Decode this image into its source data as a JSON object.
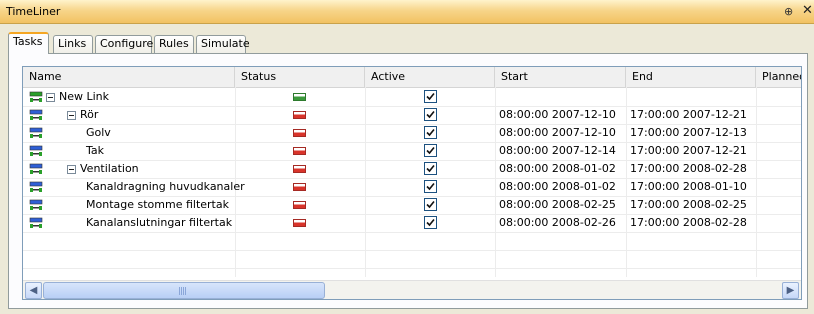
{
  "window": {
    "title": "TimeLiner",
    "pin_glyph": "⊕",
    "close_glyph": "✕"
  },
  "tabs": [
    "Tasks",
    "Links",
    "Configure",
    "Rules",
    "Simulate"
  ],
  "columns": [
    "Name",
    "Status",
    "Active",
    "Start",
    "End",
    "Planned"
  ],
  "rows": [
    {
      "name": "New Link",
      "level": 0,
      "expander": "⊟",
      "status": "green",
      "active": true,
      "start": "",
      "end": ""
    },
    {
      "name": "Rör",
      "level": 1,
      "expander": "⊟",
      "status": "red",
      "active": true,
      "start": "08:00:00 2007-12-10",
      "end": "17:00:00 2007-12-21"
    },
    {
      "name": "Golv",
      "level": 2,
      "expander": "",
      "status": "red",
      "active": true,
      "start": "08:00:00 2007-12-10",
      "end": "17:00:00 2007-12-13"
    },
    {
      "name": "Tak",
      "level": 2,
      "expander": "",
      "status": "red",
      "active": true,
      "start": "08:00:00 2007-12-14",
      "end": "17:00:00 2007-12-21"
    },
    {
      "name": "Ventilation",
      "level": 1,
      "expander": "⊟",
      "status": "red",
      "active": true,
      "start": "08:00:00 2008-01-02",
      "end": "17:00:00 2008-02-28"
    },
    {
      "name": "Kanaldragning huvudkanaler",
      "level": 2,
      "expander": "",
      "status": "red",
      "active": true,
      "start": "08:00:00 2008-01-02",
      "end": "17:00:00 2008-01-10"
    },
    {
      "name": "Montage stomme filtertak",
      "level": 2,
      "expander": "",
      "status": "red",
      "active": true,
      "start": "08:00:00 2008-02-25",
      "end": "17:00:00 2008-02-25"
    },
    {
      "name": "Kanalanslutningar filtertak",
      "level": 2,
      "expander": "",
      "status": "red",
      "active": true,
      "start": "08:00:00 2008-02-26",
      "end": "17:00:00 2008-02-28"
    }
  ],
  "scroll": {
    "left_arrow": "◀",
    "right_arrow": "▶"
  },
  "colors": {
    "accent": "#f5a623",
    "status_green": "#3c9a3c",
    "status_red": "#d9342b",
    "task_icon": "#2f5fd6",
    "task_icon_parent": "#2aa02a"
  }
}
